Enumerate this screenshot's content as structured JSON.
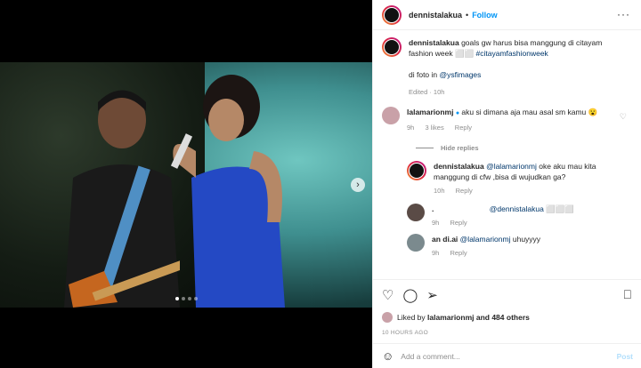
{
  "header": {
    "username": "dennistalakua",
    "separator": "•",
    "follow_label": "Follow",
    "more_label": "···"
  },
  "caption": {
    "username": "dennistalakua",
    "text": "goals gw harus bisa manggung di citayam fashion week ⬜⬜",
    "hashtag": "#citayamfashionweek",
    "credit_prefix": "di foto in",
    "credit_link": "@ysfimages",
    "meta": "Edited · 10h"
  },
  "comments": [
    {
      "username": "lalamarionmj",
      "text": "aku si dimana aja mau asal sm kamu 😮",
      "time": "9h",
      "likes": "3 likes",
      "reply": "Reply"
    }
  ],
  "hide_replies": "Hide replies",
  "replies": [
    {
      "username": "dennistalakua",
      "mention": "@lalamarionmj",
      "text": "oke aku mau kita manggung di cfw ,bisa di wujudkan ga?",
      "time": "10h",
      "reply": "Reply"
    },
    {
      "username": ".",
      "mention": "@dennistalakua",
      "text": "⬜⬜⬜",
      "time": "9h",
      "reply": "Reply"
    },
    {
      "username": "an di.ai",
      "mention": "@lalamarionmj",
      "text": "uhuyyyy",
      "time": "9h",
      "reply": "Reply"
    }
  ],
  "likes": {
    "prefix": "Liked by",
    "user": "lalamarionmj",
    "suffix": "and 484 others"
  },
  "timestamp": "10 HOURS AGO",
  "add_comment": {
    "placeholder": "Add a comment...",
    "post_label": "Post"
  },
  "icons": {
    "heart": "heart-icon",
    "comment": "comment-icon",
    "share": "share-icon",
    "save": "bookmark-icon",
    "emoji": "emoji-icon",
    "next": "chevron-right-icon"
  },
  "carousel": {
    "slides": 4,
    "active_index": 0
  },
  "colors": {
    "link": "#0095f6",
    "follow": "#0095f6",
    "muted": "#8e8e8e"
  }
}
